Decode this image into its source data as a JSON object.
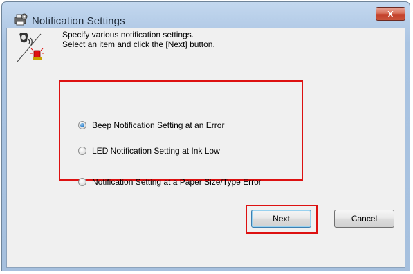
{
  "window": {
    "title": "Notification Settings",
    "close_label": "X"
  },
  "description": {
    "line1": "Specify various notification settings.",
    "line2": "Select an item and click the [Next] button."
  },
  "options": [
    {
      "label": "Beep Notification Setting at an Error",
      "selected": true
    },
    {
      "label": "LED Notification Setting at Ink Low",
      "selected": false
    },
    {
      "label": "Notification Setting at a Paper Size/Type Error",
      "selected": false
    }
  ],
  "buttons": {
    "next_label": "Next",
    "cancel_label": "Cancel"
  },
  "colors": {
    "highlight": "#dd1111",
    "selected_radio": "#2e7fc9"
  }
}
